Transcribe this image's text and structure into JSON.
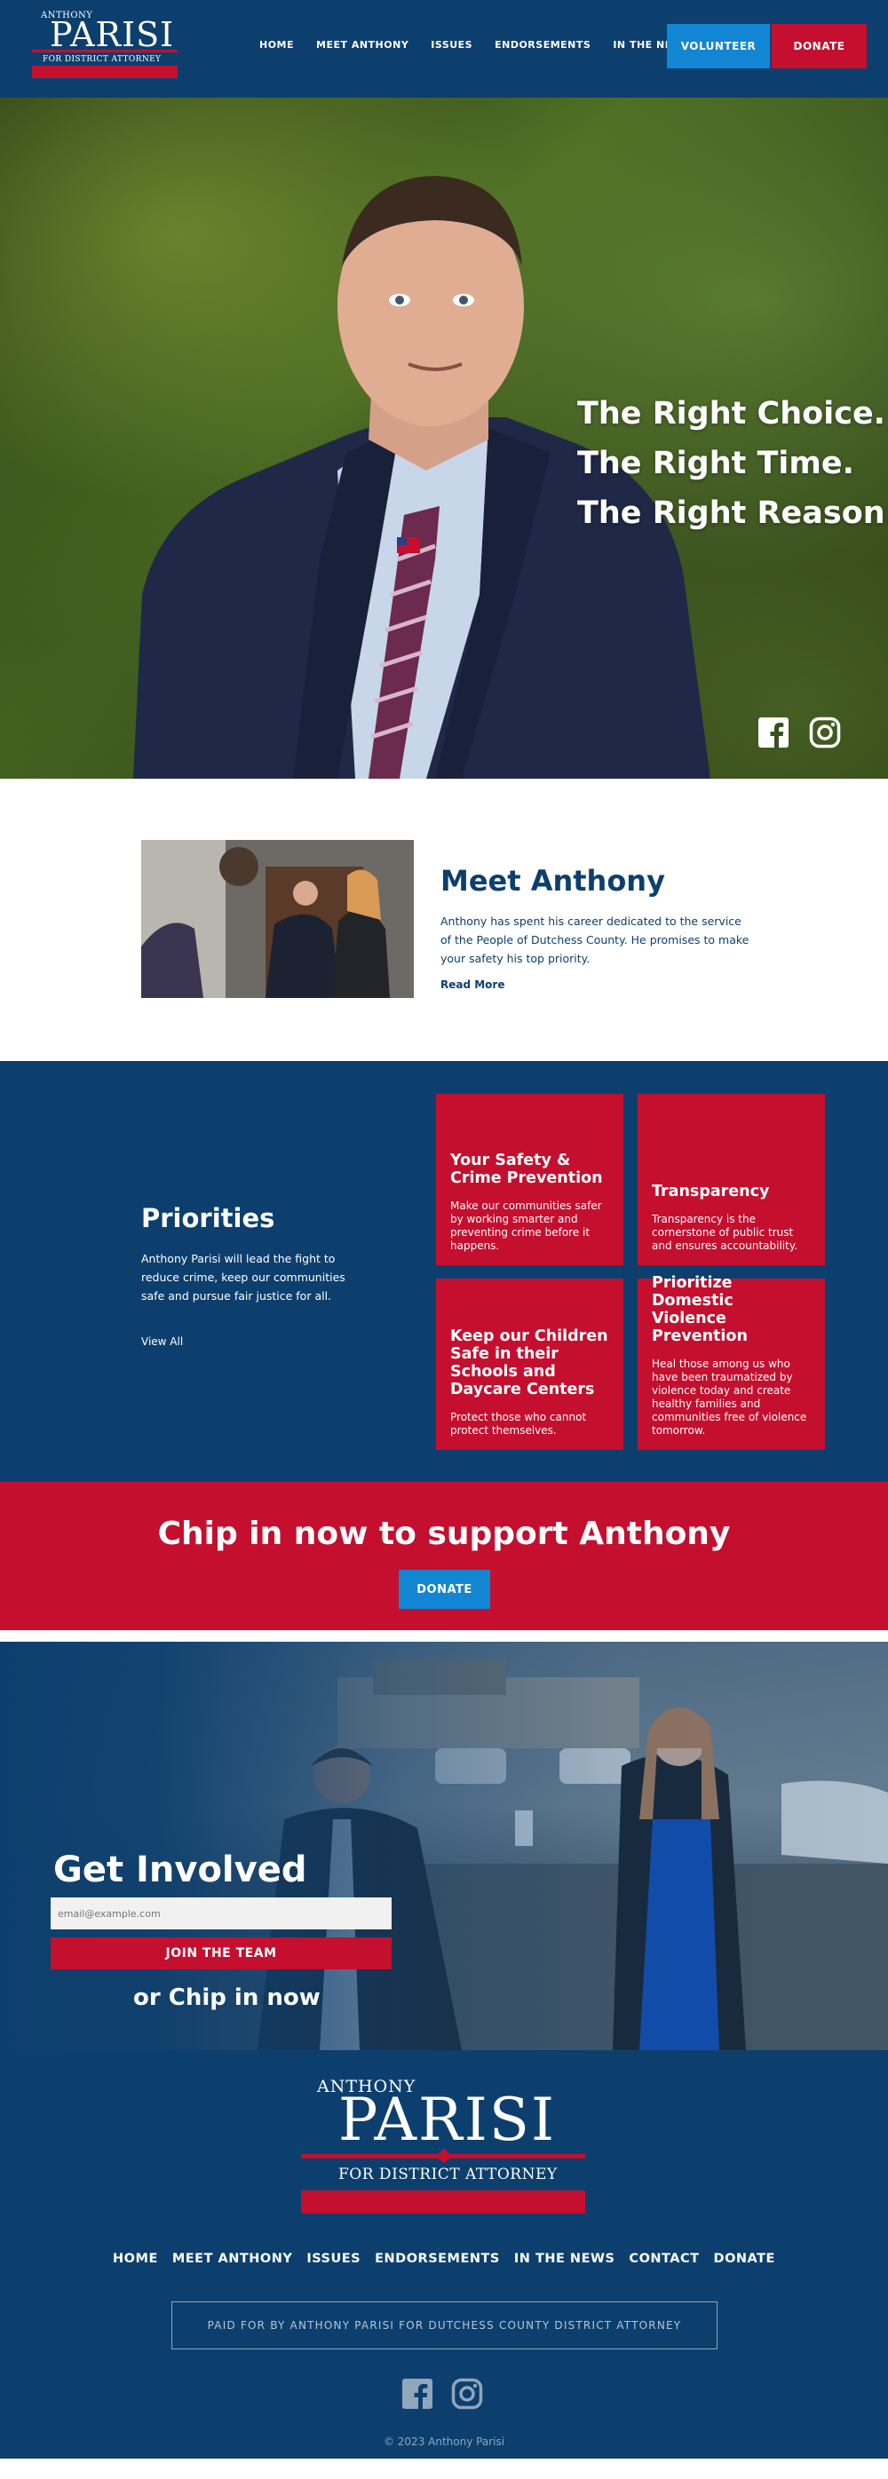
{
  "logo": {
    "first": "ANTHONY",
    "last": "PARISI",
    "office": "FOR DISTRICT ATTORNEY"
  },
  "nav": {
    "items": [
      "HOME",
      "MEET ANTHONY",
      "ISSUES",
      "ENDORSEMENTS",
      "IN THE NEWS"
    ],
    "volunteer": "VOLUNTEER",
    "donate": "DONATE"
  },
  "hero": {
    "lines": [
      "The Right Choice.",
      "The Right Time.",
      "The Right Reason."
    ],
    "social_icons": [
      "facebook-icon",
      "instagram-icon"
    ]
  },
  "meet": {
    "title": "Meet Anthony",
    "text": "Anthony has spent his career dedicated to the service of the People of Dutchess County. He promises to make your safety his top priority.",
    "link": "Read More"
  },
  "priorities": {
    "title": "Priorities",
    "text": "Anthony Parisi will lead the fight to reduce crime, keep our communities safe and pursue fair justice for all.",
    "link": "View All",
    "cards": [
      {
        "title": "Your Safety & Crime Prevention",
        "desc": "Make our communities safer by working smarter and preventing crime before it happens."
      },
      {
        "title": "Transparency",
        "desc": "Transparency is the cornerstone of public trust and ensures accountability."
      },
      {
        "title": "Keep our Children Safe in their Schools and Daycare Centers",
        "desc": "Protect those who cannot protect themselves."
      },
      {
        "title": "Prioritize Domestic Violence Prevention",
        "desc": "Heal those among us who have been traumatized by violence today and create healthy families and communities free of violence tomorrow."
      }
    ]
  },
  "chip": {
    "title": "Chip in now to support Anthony",
    "button": "DONATE"
  },
  "involved": {
    "title": "Get Involved",
    "placeholder": "email@example.com",
    "button": "JOIN THE TEAM",
    "chip": "or Chip in now"
  },
  "footer": {
    "nav": [
      "HOME",
      "MEET ANTHONY",
      "ISSUES",
      "ENDORSEMENTS",
      "IN THE NEWS",
      "CONTACT",
      "DONATE"
    ],
    "paid": "PAID FOR BY ANTHONY PARISI FOR DUTCHESS COUNTY DISTRICT ATTORNEY",
    "copyright": "© 2023 Anthony Parisi"
  },
  "colors": {
    "navy": "#0d3f6e",
    "red": "#c40f2f",
    "blue": "#1286d2"
  }
}
